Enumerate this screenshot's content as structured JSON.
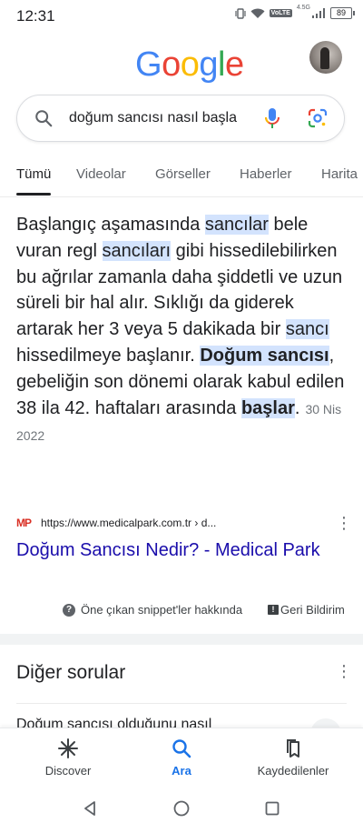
{
  "status_bar": {
    "time": "12:31",
    "volte": "VoLTE",
    "network": "4.5G",
    "battery": "89"
  },
  "header": {
    "logo_letters": [
      "G",
      "o",
      "o",
      "g",
      "l",
      "e"
    ],
    "logo_colors": [
      "#4285F4",
      "#EA4335",
      "#FBBC05",
      "#4285F4",
      "#34A853",
      "#EA4335"
    ]
  },
  "search": {
    "query": "doğum sancısı nasıl başla"
  },
  "tabs": [
    {
      "label": "Tümü",
      "active": true
    },
    {
      "label": "Videolar"
    },
    {
      "label": "Görseller"
    },
    {
      "label": "Haberler"
    },
    {
      "label": "Harita"
    }
  ],
  "snippet": {
    "t1": "Başlangıç aşamasında ",
    "h1": "sancılar",
    "t2": " bele vuran regl ",
    "h2": "sancıları",
    "t3": " gibi hissedilebilirken bu ağrılar zamanla daha şiddetli ve uzun süreli bir hal alır. Sıklığı da giderek artarak her 3 veya 5 dakikada bir ",
    "h3": "sancı",
    "t4": " hissedilmeye başlanır. ",
    "h4": "Doğum sancısı",
    "t5": ", gebeliğin son dönemi olarak kabul edilen 38 ila 42. haftaları arasında ",
    "h5": "başlar",
    "t6": ".",
    "date": "30 Nis 2022"
  },
  "source": {
    "favicon": "MP",
    "url": "https://www.medicalpark.com.tr › d...",
    "title": "Doğum Sancısı Nedir? - Medical Park"
  },
  "about": {
    "snippets_label": "Öne çıkan snippet'ler hakkında",
    "feedback_label": "Geri Bildirim"
  },
  "other_questions": {
    "title": "Diğer sorular",
    "first_question": "Doğum sancısı olduğunu nasıl"
  },
  "bottom_nav": [
    {
      "label": "Discover",
      "icon": "asterisk-icon"
    },
    {
      "label": "Ara",
      "icon": "search-icon",
      "active": true
    },
    {
      "label": "Kaydedilenler",
      "icon": "bookmarks-icon"
    }
  ],
  "colors": {
    "accent": "#1a73e8",
    "link": "#1a0dab",
    "highlight": "#d3e3fd"
  }
}
